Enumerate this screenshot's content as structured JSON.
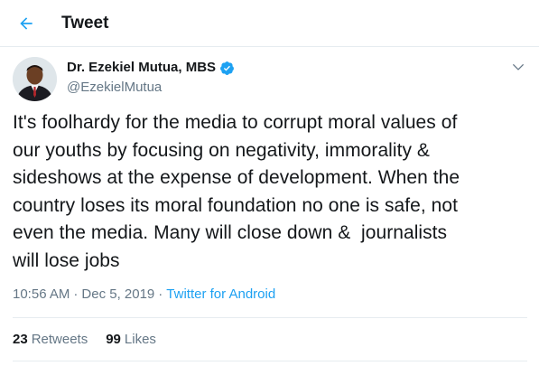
{
  "header": {
    "title": "Tweet",
    "back_icon": "arrow-left-icon"
  },
  "author": {
    "name": "Dr. Ezekiel Mutua, MBS",
    "handle": "@EzekielMutua",
    "verified_icon": "verified-badge-icon",
    "avatar": "avatar"
  },
  "menu": {
    "icon": "chevron-down-icon"
  },
  "tweet": {
    "text": "It's foolhardy for the media to corrupt moral values of\nour youths by focusing on negativity, immorality &\nsideshows at the expense of development. When the\ncountry loses its moral foundation no one is safe, not\neven the media. Many will close down &  journalists\nwill lose jobs"
  },
  "meta": {
    "time": "10:56 AM",
    "separator": "·",
    "date": "Dec 5, 2019",
    "source": "Twitter for Android"
  },
  "stats": {
    "retweets_count": "23",
    "retweets_label": "Retweets",
    "likes_count": "99",
    "likes_label": "Likes"
  },
  "colors": {
    "accent": "#1da1f2",
    "text": "#14171a",
    "muted": "#657786",
    "border": "#e6ecf0"
  }
}
